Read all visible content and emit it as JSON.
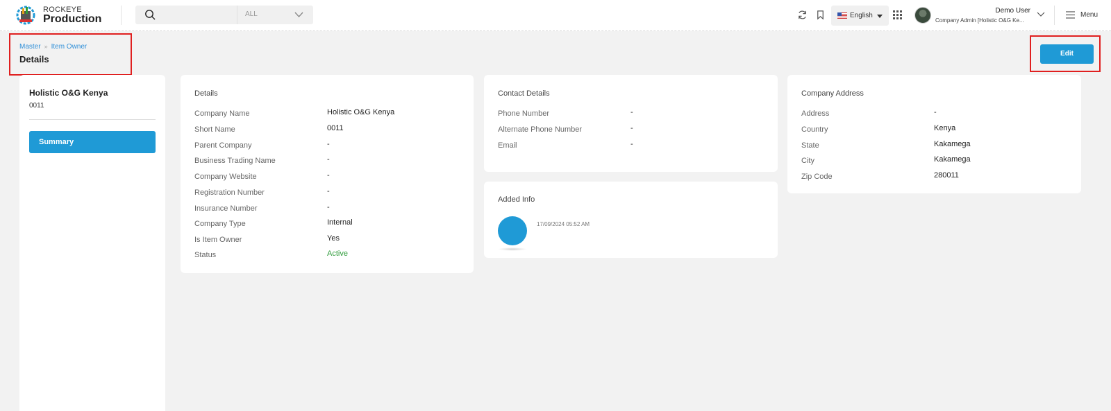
{
  "brand": {
    "top": "ROCKEYE",
    "main": "Production"
  },
  "search": {
    "scope": "ALL"
  },
  "language": "English",
  "user": {
    "name": "Demo User",
    "role": "Company Admin [Holistic O&G Ke..."
  },
  "menu_label": "Menu",
  "breadcrumb": {
    "items": [
      "Master",
      "Item Owner"
    ]
  },
  "page_title": "Details",
  "edit_label": "Edit",
  "sidebar": {
    "org_name": "Holistic O&G Kenya",
    "org_code": "0011",
    "summary_label": "Summary"
  },
  "details": {
    "title": "Details",
    "rows": [
      {
        "label": "Company Name",
        "value": "Holistic O&G Kenya"
      },
      {
        "label": "Short Name",
        "value": "0011"
      },
      {
        "label": "Parent Company",
        "value": "-"
      },
      {
        "label": "Business Trading Name",
        "value": "-"
      },
      {
        "label": "Company Website",
        "value": "-"
      },
      {
        "label": "Registration Number",
        "value": "-"
      },
      {
        "label": "Insurance Number",
        "value": "-"
      },
      {
        "label": "Company Type",
        "value": "Internal"
      },
      {
        "label": "Is Item Owner",
        "value": "Yes"
      },
      {
        "label": "Status",
        "value": "Active"
      }
    ]
  },
  "contact": {
    "title": "Contact Details",
    "rows": [
      {
        "label": "Phone Number",
        "value": "-"
      },
      {
        "label": "Alternate Phone Number",
        "value": "-"
      },
      {
        "label": "Email",
        "value": "-"
      }
    ]
  },
  "added_info": {
    "title": "Added Info",
    "timestamp": "17/09/2024 05:52 AM"
  },
  "address": {
    "title": "Company Address",
    "rows": [
      {
        "label": "Address",
        "value": "-"
      },
      {
        "label": "Country",
        "value": "Kenya"
      },
      {
        "label": "State",
        "value": "Kakamega"
      },
      {
        "label": "City",
        "value": "Kakamega"
      },
      {
        "label": "Zip Code",
        "value": "280011"
      }
    ]
  },
  "colors": {
    "accent": "#1f9ad6",
    "status_active": "#2e9b3a",
    "highlight": "#e01f1f"
  },
  "icons": [
    "gear-logo-icon",
    "search-icon",
    "chevron-down-icon",
    "refresh-icon",
    "bookmark-icon",
    "us-flag-icon",
    "caret-down-icon",
    "apps-grid-icon",
    "hamburger-icon"
  ]
}
